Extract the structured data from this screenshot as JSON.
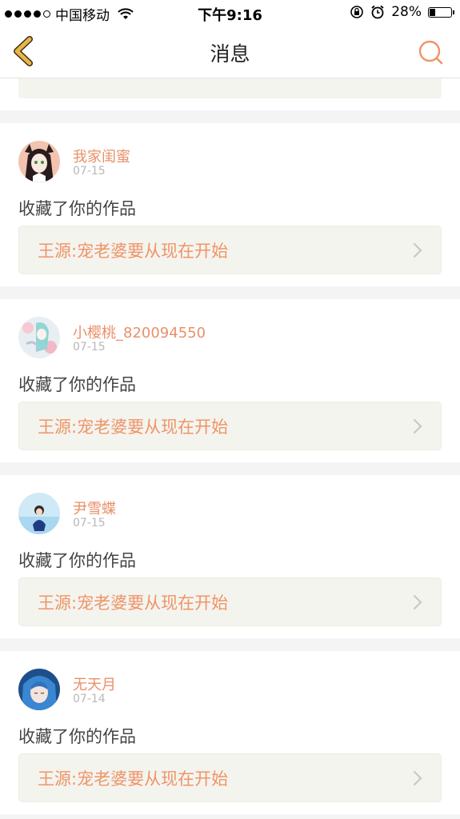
{
  "status_bar": {
    "carrier": "中国移动",
    "time": "下午9:16",
    "battery": "28%"
  },
  "nav": {
    "title": "消息"
  },
  "messages": [
    {
      "user": "我家闺蜜",
      "date": "07-15",
      "action": "收藏了你的作品",
      "work": "王源:宠老婆要从现在开始"
    },
    {
      "user": "小樱桃_820094550",
      "date": "07-15",
      "action": "收藏了你的作品",
      "work": "王源:宠老婆要从现在开始"
    },
    {
      "user": "尹雪蝶",
      "date": "07-15",
      "action": "收藏了你的作品",
      "work": "王源:宠老婆要从现在开始"
    },
    {
      "user": "无天月",
      "date": "07-14",
      "action": "收藏了你的作品",
      "work": "王源:宠老婆要从现在开始"
    }
  ],
  "colors": {
    "accent": "#e9906a",
    "work_title": "#ef9468",
    "back_arrow": "#e8b54a",
    "box_bg": "#f4f4ee"
  }
}
